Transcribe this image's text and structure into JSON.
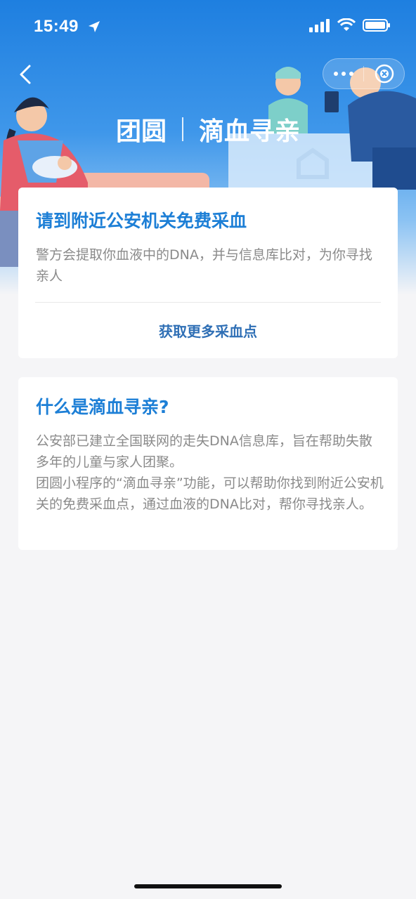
{
  "status_bar": {
    "time": "15:49",
    "icons": [
      "location-arrow-icon",
      "signal-icon",
      "wifi-icon",
      "battery-icon"
    ]
  },
  "nav": {
    "back_icon": "chevron-left-icon",
    "more_icon": "more-dots-icon",
    "close_icon": "close-circle-icon"
  },
  "header": {
    "brand": "团圆",
    "title": "滴血寻亲"
  },
  "card1": {
    "title": "请到附近公安机关免费采血",
    "text": "警方会提取你血液中的DNA，并与信息库比对，为你寻找亲人",
    "link": "获取更多采血点"
  },
  "card2": {
    "title": "什么是滴血寻亲?",
    "text": "公安部已建立全国联网的走失DNA信息库，旨在帮助失散多年的儿童与家人团聚。\n团圆小程序的“滴血寻亲”功能，可以帮助你找到附近公安机关的免费采血点，通过血液的DNA比对，帮你寻找亲人。"
  },
  "colors": {
    "accent": "#1d7fd6",
    "link": "#2f6fb5",
    "hero": "#1e7fe0",
    "background": "#f5f5f7"
  }
}
